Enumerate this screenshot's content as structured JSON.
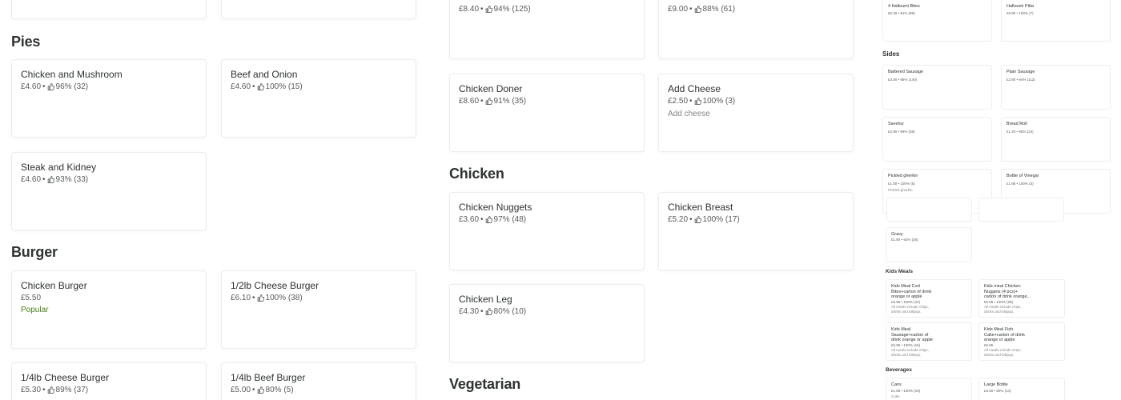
{
  "colors": {
    "text": "#2e3333",
    "meta": "#585c5c",
    "popular": "#4d7c1b",
    "border": "#ececec"
  },
  "icons": {
    "rating": "thumbs-up-icon"
  },
  "col1": {
    "pies_title": "Pies",
    "pies": [
      {
        "name": "Chicken and Mushroom",
        "price": "£4.60",
        "rating": "96% (32)"
      },
      {
        "name": "Beef and Onion",
        "price": "£4.60",
        "rating": "100% (15)"
      },
      {
        "name": "Steak and Kidney",
        "price": "£4.60",
        "rating": "93% (33)"
      }
    ],
    "burger_title": "Burger",
    "burgers": [
      {
        "name": "Chicken Burger",
        "price": "£5.50",
        "popular": "Popular"
      },
      {
        "name": "1/2lb Cheese Burger",
        "price": "£6.10",
        "rating": "100% (38)"
      },
      {
        "name": "1/4lb Cheese Burger",
        "price": "£5.30",
        "rating": "89% (37)"
      },
      {
        "name": "1/4lb Beef Burger",
        "price": "£5.00",
        "rating": "80% (5)"
      }
    ]
  },
  "col2": {
    "top": [
      {
        "price": "£8.40",
        "rating": "94% (125)"
      },
      {
        "price": "£9.00",
        "rating": "88% (61)"
      }
    ],
    "items": [
      {
        "name": "Chicken Doner",
        "price": "£8.60",
        "rating": "91% (35)"
      },
      {
        "name": "Add Cheese",
        "price": "£2.50",
        "rating": "100% (3)",
        "desc": "Add cheese"
      }
    ],
    "chicken_title": "Chicken",
    "chicken": [
      {
        "name": "Chicken Nuggets",
        "price": "£3.60",
        "rating": "97% (48)"
      },
      {
        "name": "Chicken Breast",
        "price": "£5.20",
        "rating": "100% (17)"
      },
      {
        "name": "Chicken Leg",
        "price": "£4.30",
        "rating": "80% (10)"
      }
    ],
    "vegetarian_title": "Vegetarian"
  },
  "col3": {
    "top": [
      {
        "name": "4 Halloumi Bites",
        "meta": "£5.20 • 91% (89)"
      },
      {
        "name": "Halloumi Pitta",
        "meta": "£6.90 • 100% (7)"
      }
    ],
    "sides_title": "Sides",
    "sides": [
      {
        "name": "Battered Sausage",
        "meta": "£3.00 • 95% (140)"
      },
      {
        "name": "Plain Sausage",
        "meta": "£2.80 • 94% (112)"
      },
      {
        "name": "Saveloy",
        "meta": "£2.90 • 96% (56)"
      },
      {
        "name": "Bread Roll",
        "meta": "£1.20 • 95% (24)"
      },
      {
        "name": "Pickled gherkin",
        "meta": "£1.00 • 100% (5)",
        "desc": "Pickled gherkin"
      },
      {
        "name": "Bottle of Vinegar",
        "meta": "£1.95 • 100% (3)"
      }
    ],
    "gravy": {
      "name": "Gravy",
      "meta": "£1.80 • 92% (26)"
    },
    "kids_title": "Kids Meals",
    "kids": [
      {
        "name1": "Kids Meal Cod",
        "name2": "Bites+carton of drink",
        "name3": "orange or apple",
        "meta": "£5.95 • 100% (22)",
        "d1": "All meals include chips,",
        "d2": "drinks and lollipop."
      },
      {
        "name1": "Kids meal Chicken",
        "name2": "Nuggets (4 pcs)+",
        "name3": "carton of drink orange...",
        "meta": "£5.95 • 100% (28)",
        "d1": "All meals include chips,",
        "d2": "drinks and lollipop."
      },
      {
        "name1": "Kids Meal",
        "name2": "Sausage+carton of",
        "name3": "drink orange or apple",
        "meta": "£5.95 • 100% (18)",
        "d1": "All meals include chips,",
        "d2": "drinks and lollipop."
      },
      {
        "name1": "Kids Meal Fish",
        "name2": "Cake+carton of drink",
        "name3": "orange or apple",
        "meta": "£5.95",
        "d1": "All meals include chips,",
        "d2": "drinks and lollipop."
      }
    ],
    "beverages_title": "Beverages",
    "beverages": [
      {
        "name": "Cans",
        "meta": "£1.80 • 100% (19)",
        "desc": "Coke"
      },
      {
        "name": "Large Bottle",
        "meta": "£3.60 • 80% (14)"
      }
    ]
  }
}
